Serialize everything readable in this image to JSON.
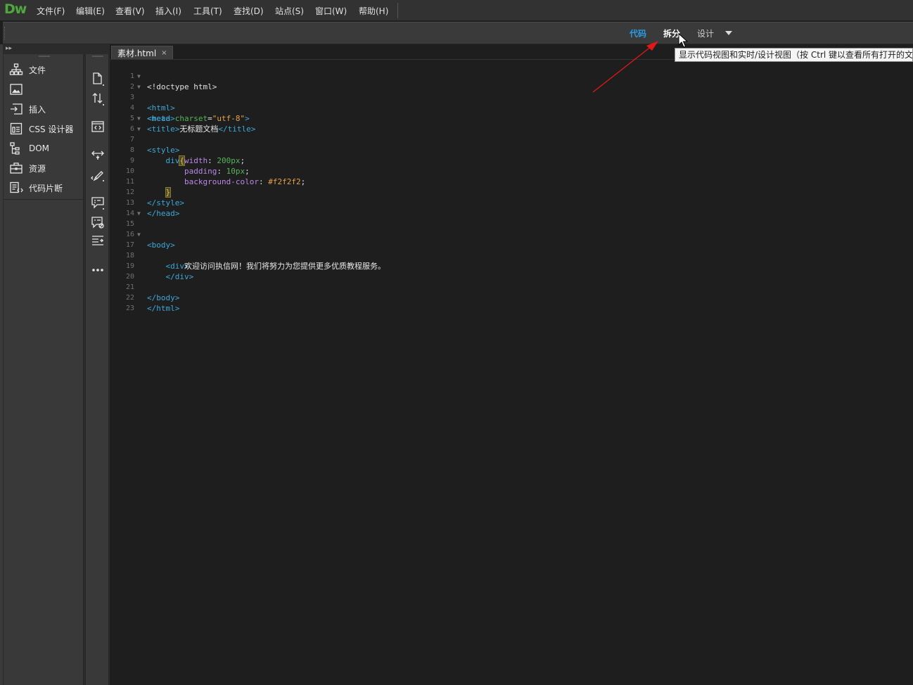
{
  "app": {
    "logo": "Dw"
  },
  "menu": {
    "items": [
      "文件(F)",
      "编辑(E)",
      "查看(V)",
      "插入(I)",
      "工具(T)",
      "查找(D)",
      "站点(S)",
      "窗口(W)",
      "帮助(H)"
    ]
  },
  "view_switcher": {
    "code": "代码",
    "split": "拆分",
    "design": "设计",
    "active": "拆分",
    "dropdown_icon": "caret-down-icon"
  },
  "panels": {
    "collapse_icon": "double-chevron-icon",
    "items": [
      {
        "label": "文件",
        "icon": "files-tree-icon"
      },
      {
        "label": "",
        "icon": "assets-image-icon"
      },
      {
        "label": "插入",
        "icon": "insert-icon"
      },
      {
        "label": "CSS 设计器",
        "icon": "css-designer-icon"
      },
      {
        "label": "DOM",
        "icon": "dom-tree-icon"
      },
      {
        "label": "资源",
        "icon": "assets-icon"
      },
      {
        "label": "代码片断",
        "icon": "snippets-icon"
      }
    ]
  },
  "code_toolbar": {
    "buttons": [
      "open-document-icon",
      "file-management-icon",
      "code-view-icon",
      "expand-tag-icon",
      "format-icon",
      "apply-comment-icon",
      "remove-comment-icon",
      "indent-icon",
      "more-icon"
    ]
  },
  "document": {
    "tab_label": "素材.html",
    "close_symbol": "×"
  },
  "tooltip": {
    "text": "显示代码视图和实时/设计视图（按 Ctrl 键以查看所有打开的文"
  },
  "code": {
    "line_numbers": [
      "1",
      "2",
      "3",
      "4",
      "5",
      "6",
      "7",
      "8",
      "9",
      "10",
      "11",
      "12",
      "13",
      "14",
      "15",
      "16",
      "17",
      "18",
      "19",
      "20",
      "21",
      "22",
      "23"
    ],
    "fold_lines": [
      2,
      3,
      6,
      7,
      15,
      17
    ],
    "lines": {
      "l1": "<!doctype html>",
      "l2": "<html>",
      "l3": "<head>",
      "l4_tag_open": "<meta ",
      "l4_attr": "charset",
      "l4_eq": "=",
      "l4_val": "\"utf-8\"",
      "l4_close": ">",
      "l5_open": "<title>",
      "l5_text": "无标题文档",
      "l5_close": "</title>",
      "l6": "<style>",
      "l7_sel": "div",
      "l7_brace": "{",
      "l8_prop": "width",
      "l8_val": "200px",
      "l9_prop": "padding",
      "l9_val": "10px",
      "l10_prop": "background-color",
      "l10_val": "#f2f2f2",
      "l11_brace": "}",
      "l12": "</style>",
      "l13": "</head>",
      "l15": "<body>",
      "l17": "<div>",
      "l18_text": "欢迎访问执信网！我们将努力为您提供更多优质教程服务。",
      "l19": "</div>",
      "l21": "</body>",
      "l22": "</html>"
    }
  },
  "colors": {
    "accent_code": "#2a9be3",
    "logo": "#4fa83d",
    "annotation_arrow": "#e01818"
  }
}
